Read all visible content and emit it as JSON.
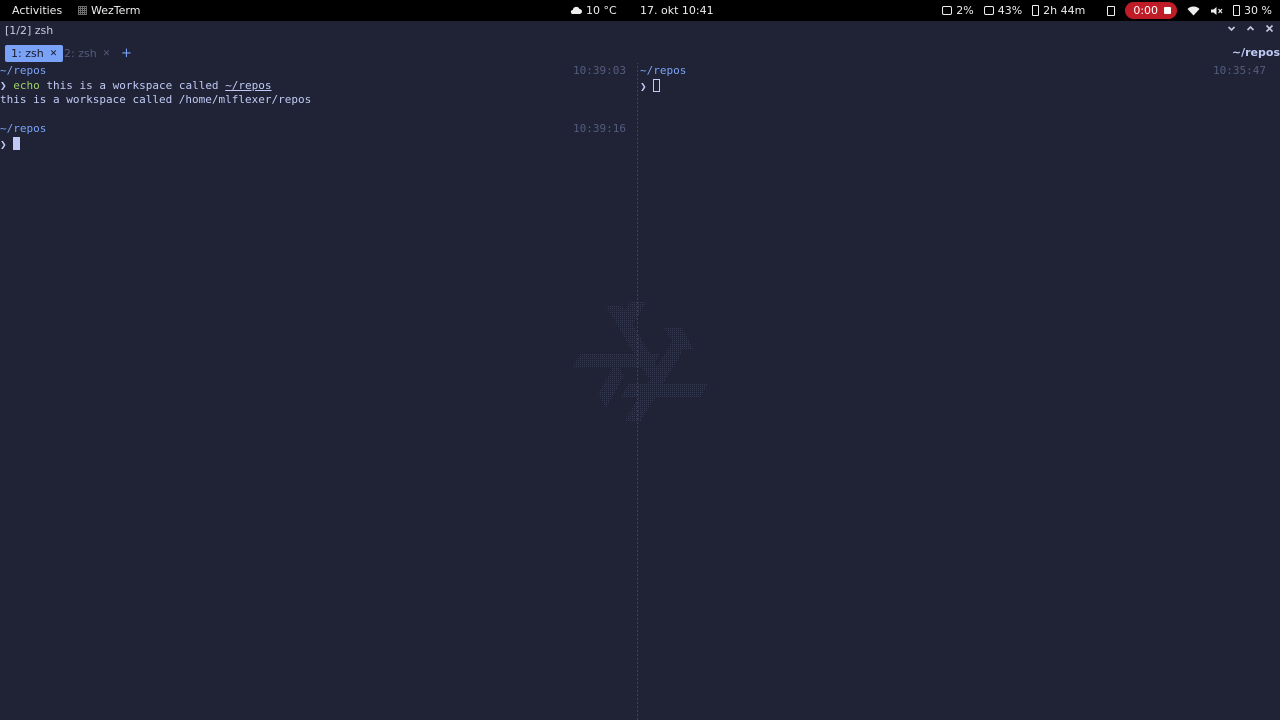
{
  "topbar": {
    "activities": "Activities",
    "app_name": "WezTerm",
    "weather": "10 °C",
    "clock": "17. okt  10:41",
    "cpu": "2%",
    "memory": "43%",
    "battery_time": "2h 44m",
    "recording_time": "0:00",
    "battery_percent": "30 %"
  },
  "window": {
    "title": "[1/2] zsh",
    "workspace": "~/repos"
  },
  "tabs": [
    {
      "label": "1: zsh",
      "close": "✕"
    },
    {
      "label": "2: zsh",
      "close": "✕"
    }
  ],
  "new_tab": "+",
  "left_pane": {
    "block1": {
      "path": "~/repos",
      "time": "10:39:03",
      "prompt": "❯",
      "command": "echo",
      "args": " this is a workspace called ",
      "arg_path": "~/repos",
      "output": "this is a workspace called /home/mlflexer/repos"
    },
    "block2": {
      "path": "~/repos",
      "time": "10:39:16",
      "prompt": "❯"
    }
  },
  "right_pane": {
    "path": "~/repos",
    "time": "10:35:47",
    "prompt": "❯"
  },
  "colors": {
    "background": "#1f2335",
    "accent": "#7aa2f7",
    "command": "#9ece6a",
    "muted": "#545c7e",
    "record": "#c01c28"
  }
}
